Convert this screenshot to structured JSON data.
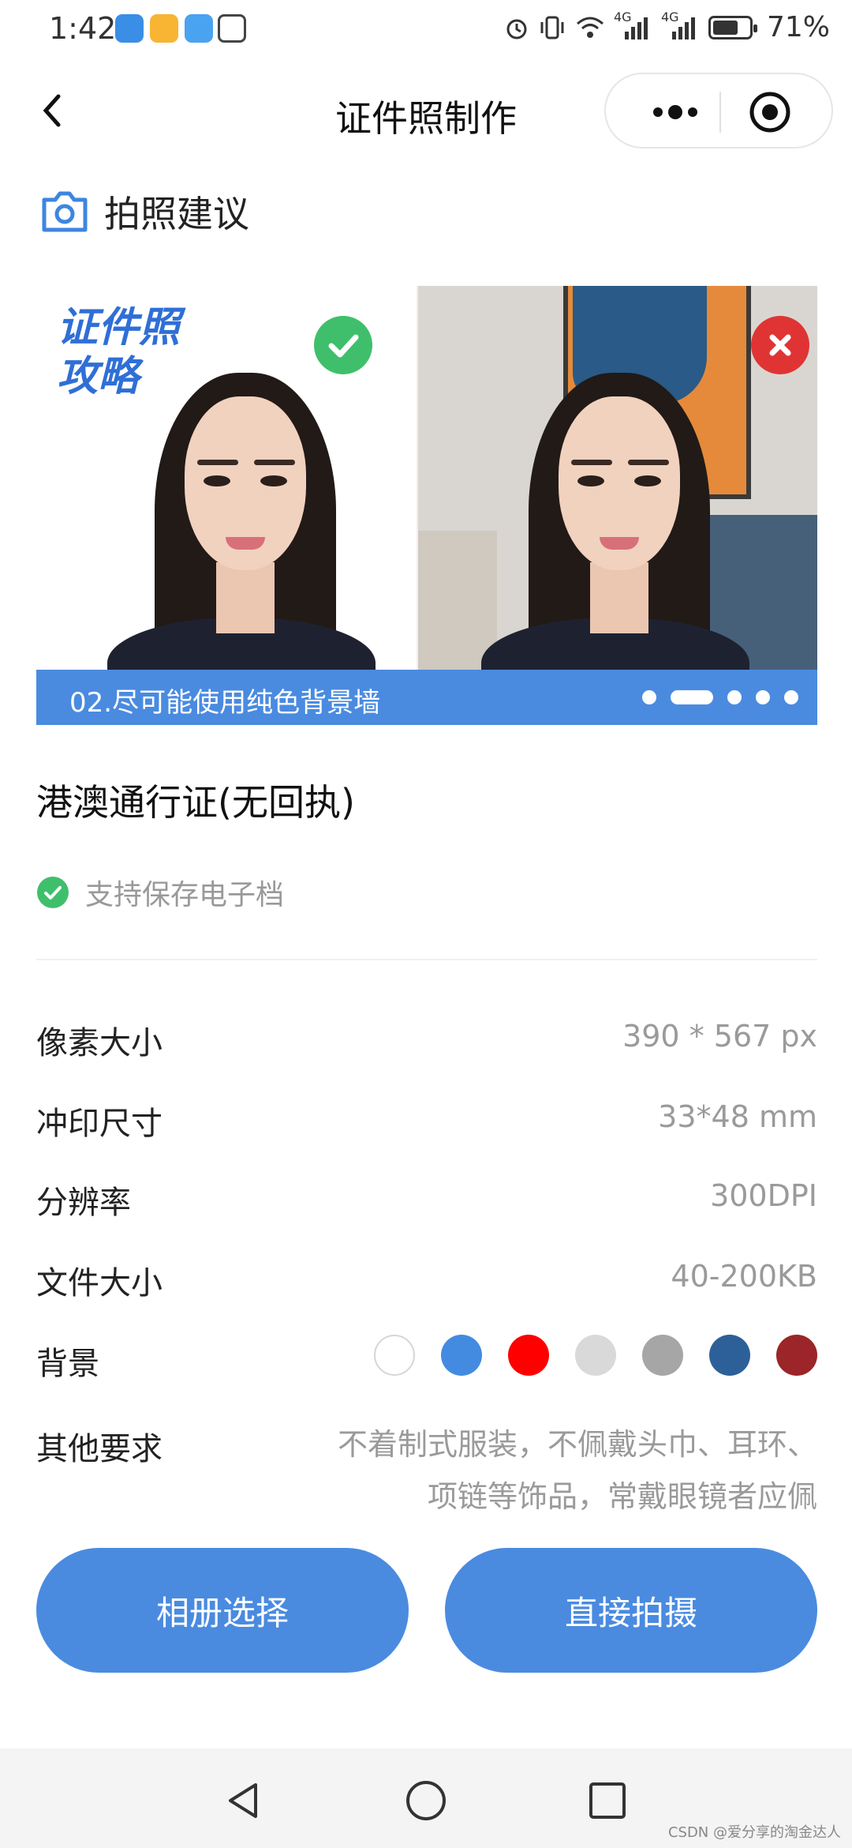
{
  "status_bar": {
    "time": "1:42",
    "battery_percent": "71%",
    "battery_level": 0.71,
    "signal_label_1": "4G",
    "signal_label_2": "4G"
  },
  "nav": {
    "title": "证件照制作",
    "back_icon": "chevron-left-icon",
    "more_icon": "more-dots-icon",
    "close_icon": "target-close-icon"
  },
  "section": {
    "icon": "camera-icon",
    "title": "拍照建议"
  },
  "banner": {
    "overlay_title_line1": "证件照",
    "overlay_title_line2": "攻略",
    "good_icon": "check-icon",
    "bad_icon": "cross-icon",
    "caption": "02.尽可能使用纯色背景墙",
    "dots_total": 5,
    "active_dot": 2
  },
  "product": {
    "title": "港澳通行证(无回执)",
    "feature_icon": "check-circle-icon",
    "feature_label": "支持保存电子档"
  },
  "specs": [
    {
      "key": "像素大小",
      "value": "390 * 567 px"
    },
    {
      "key": "冲印尺寸",
      "value": "33*48 mm"
    },
    {
      "key": "分辨率",
      "value": "300DPI"
    },
    {
      "key": "文件大小",
      "value": "40-200KB"
    }
  ],
  "background": {
    "key": "背景",
    "colors": [
      "#ffffff",
      "#438be0",
      "#ff0000",
      "#d9d9d9",
      "#a6a6a6",
      "#2d6099",
      "#9b2528"
    ]
  },
  "other": {
    "key": "其他要求",
    "value": "不着制式服装，不佩戴头巾、耳环、项链等饰品，常戴眼镜者应佩"
  },
  "buttons": {
    "album": "相册选择",
    "camera": "直接拍摄"
  },
  "sysnav": {
    "back_icon": "triangle-back-icon",
    "home_icon": "circle-home-icon",
    "recents_icon": "square-recents-icon"
  },
  "watermark": "CSDN @爱分享的淘金达人"
}
